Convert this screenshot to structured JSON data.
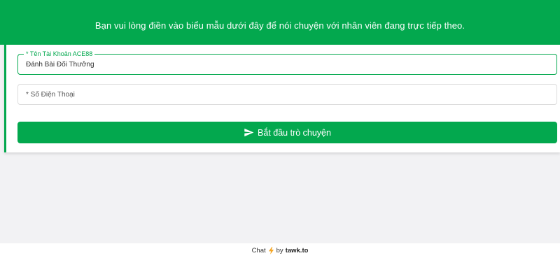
{
  "header": {
    "message": "Bạn vui lòng điền vào biểu mẫu dưới đây để nói chuyện với nhân viên đang trực tiếp theo."
  },
  "form": {
    "account_field": {
      "label": "* Tên Tài Khoản ACE88",
      "value": "Đánh Bài Đổi Thưởng"
    },
    "phone_field": {
      "placeholder": "* Số Điện Thoại",
      "value": ""
    },
    "submit_label": "Bắt đầu trò chuyện"
  },
  "footer": {
    "prefix": "Chat",
    "by": "by",
    "brand": "tawk.to"
  },
  "colors": {
    "brand_green": "#03a84e",
    "bolt": "#f5a623"
  },
  "icons": {
    "submit": "send-icon",
    "footer": "lightning-icon"
  }
}
